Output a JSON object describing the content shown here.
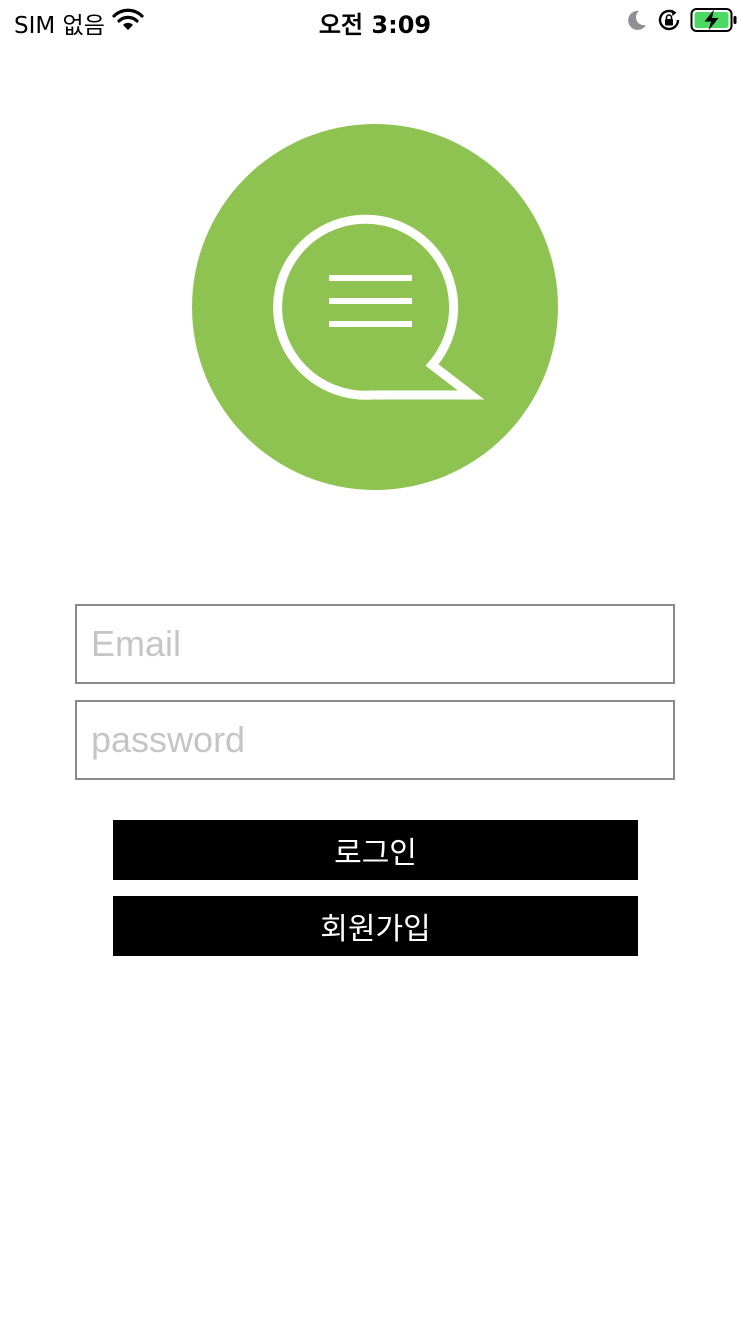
{
  "status_bar": {
    "carrier": "SIM 없음",
    "time": "오전 3:09",
    "icons": [
      "wifi-icon",
      "moon-icon",
      "lock-rotation-icon",
      "battery-charging-icon"
    ],
    "battery_color": "#4cd964"
  },
  "logo": {
    "icon": "chat-bubble-icon",
    "color": "#8fc351"
  },
  "login_form": {
    "email_placeholder": "Email",
    "email_value": "",
    "password_placeholder": "password",
    "password_value": "",
    "login_label": "로그인",
    "signup_label": "회원가입"
  }
}
